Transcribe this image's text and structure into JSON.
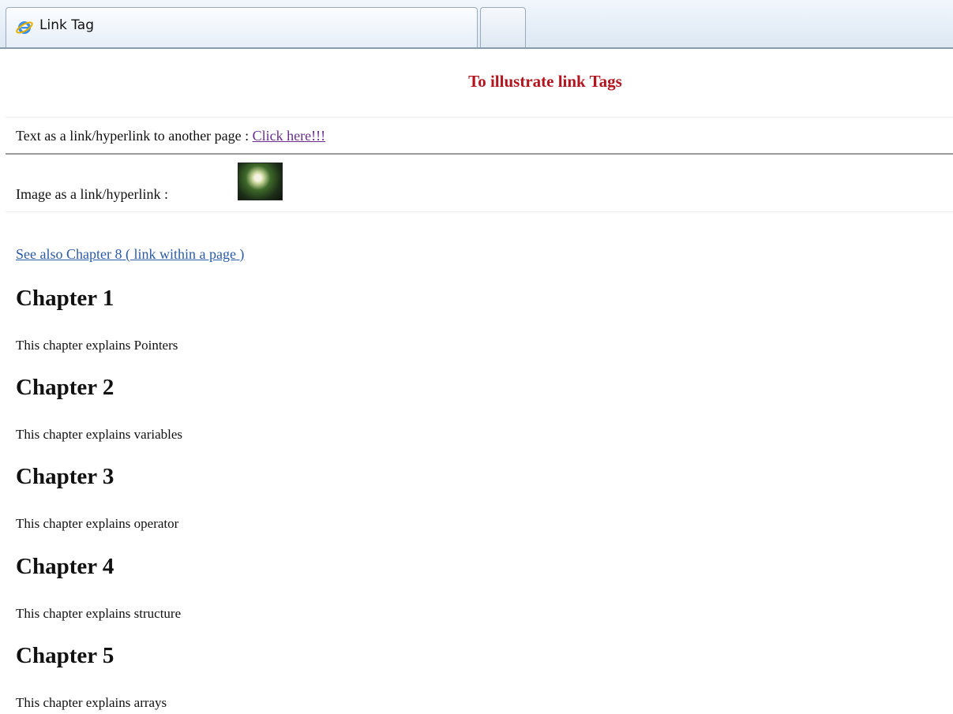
{
  "browser": {
    "tab_title": "Link Tag",
    "tab_icon": "internet-explorer-icon"
  },
  "page": {
    "heading": "To illustrate link Tags",
    "text_link_prefix": "Text as a link/hyperlink to another page :",
    "text_link_label": "Click here!!!",
    "image_link_prefix": "Image as a link/hyperlink :",
    "image_link_icon": "flower-thumbnail-icon",
    "anchor_link_label": "See also Chapter 8 ( link within a page )",
    "chapters": [
      {
        "title": "Chapter 1",
        "text": "This chapter explains Pointers"
      },
      {
        "title": "Chapter 2",
        "text": "This chapter explains variables"
      },
      {
        "title": "Chapter 3",
        "text": "This chapter explains operator"
      },
      {
        "title": "Chapter 4",
        "text": "This chapter explains structure"
      },
      {
        "title": "Chapter 5",
        "text": "This chapter explains arrays"
      }
    ]
  },
  "colors": {
    "heading": "#b3141d",
    "visited_link": "#6a2c8f",
    "link": "#2a5aa5"
  }
}
